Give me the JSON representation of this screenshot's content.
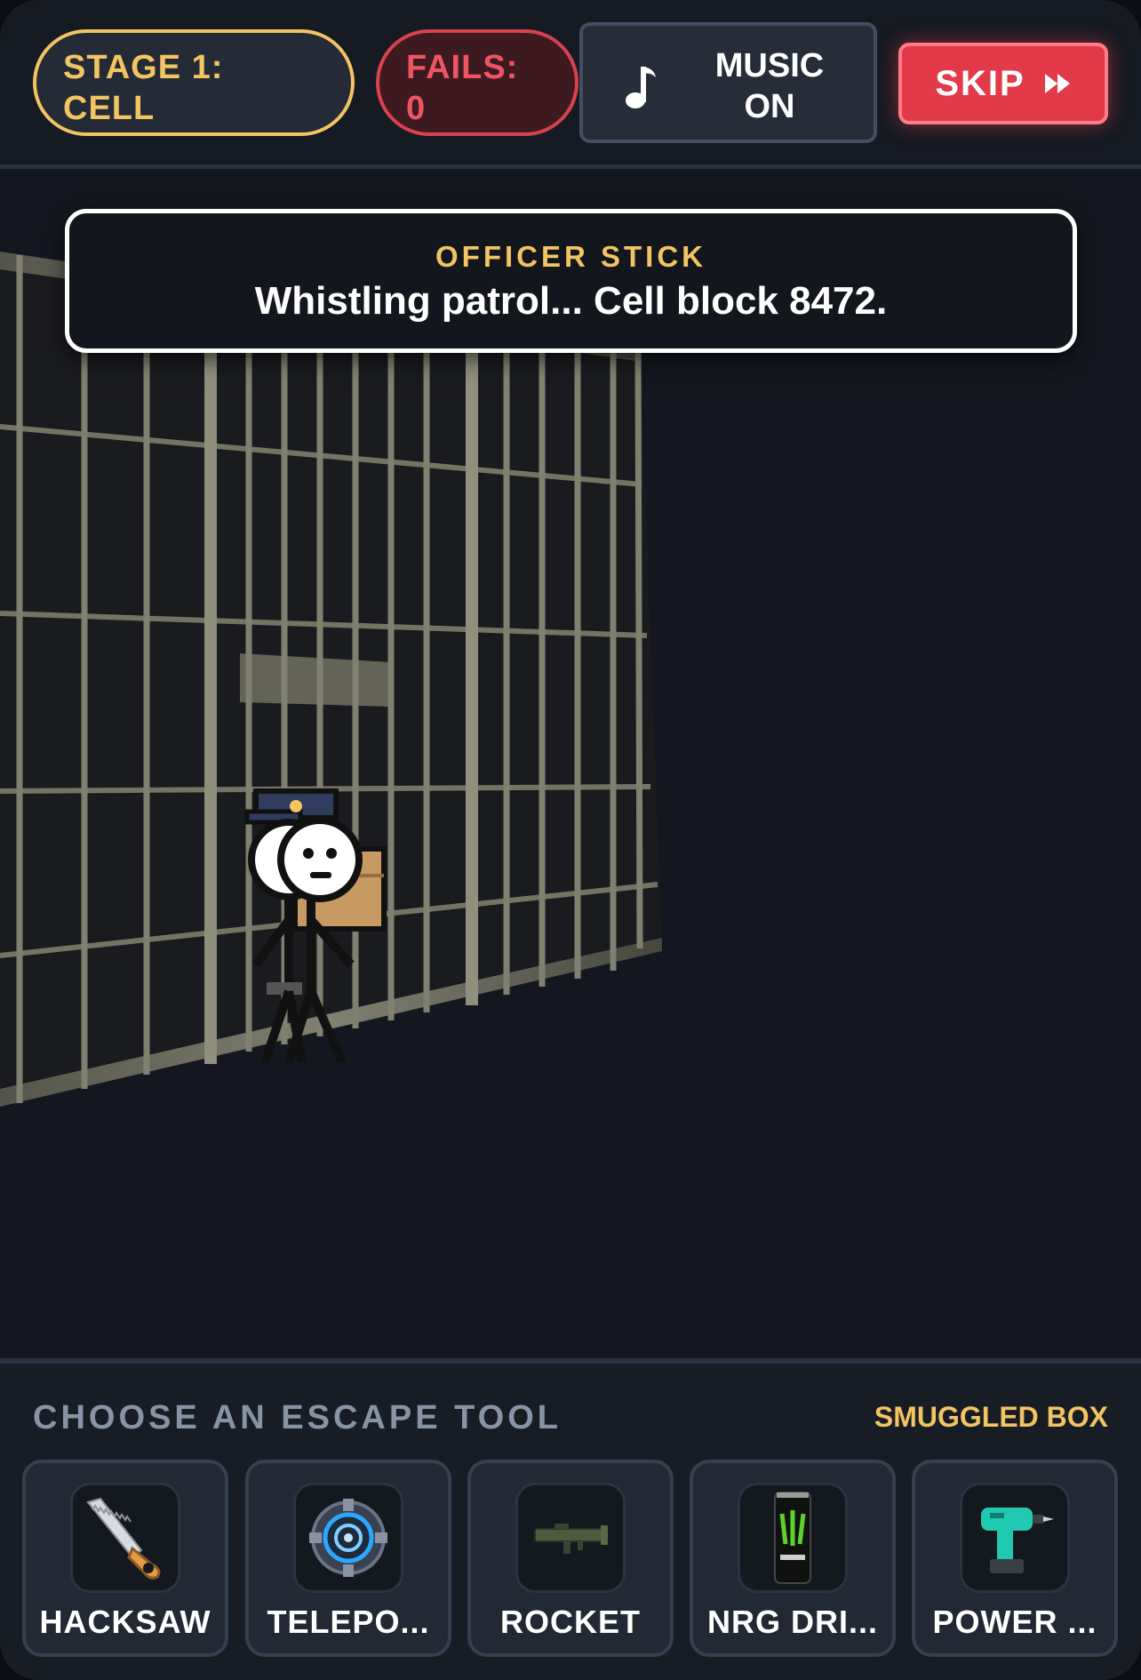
{
  "hud": {
    "stage_label": "STAGE 1:",
    "stage_name": "CELL",
    "fails_label": "FAILS:",
    "fails_count": "0",
    "music_label_1": "MUSIC",
    "music_label_2": "ON",
    "skip_label": "SKIP"
  },
  "dialog": {
    "speaker": "OFFICER STICK",
    "message": "Whistling patrol... Cell block 8472."
  },
  "tools_panel": {
    "title": "CHOOSE AN ESCAPE TOOL",
    "box_label": "SMUGGLED BOX",
    "tools": [
      {
        "label": "HACKSAW",
        "icon": "hacksaw-icon"
      },
      {
        "label": "TELEPO...",
        "icon": "teleporter-icon"
      },
      {
        "label": "ROCKET",
        "icon": "rocket-launcher-icon"
      },
      {
        "label": "NRG DRI...",
        "icon": "energy-drink-icon"
      },
      {
        "label": "POWER ...",
        "icon": "power-drill-icon"
      }
    ]
  },
  "colors": {
    "accent_gold": "#f2c462",
    "danger_red": "#e33a4a",
    "panel_bg": "#181c25",
    "scene_bg": "#14171f"
  }
}
